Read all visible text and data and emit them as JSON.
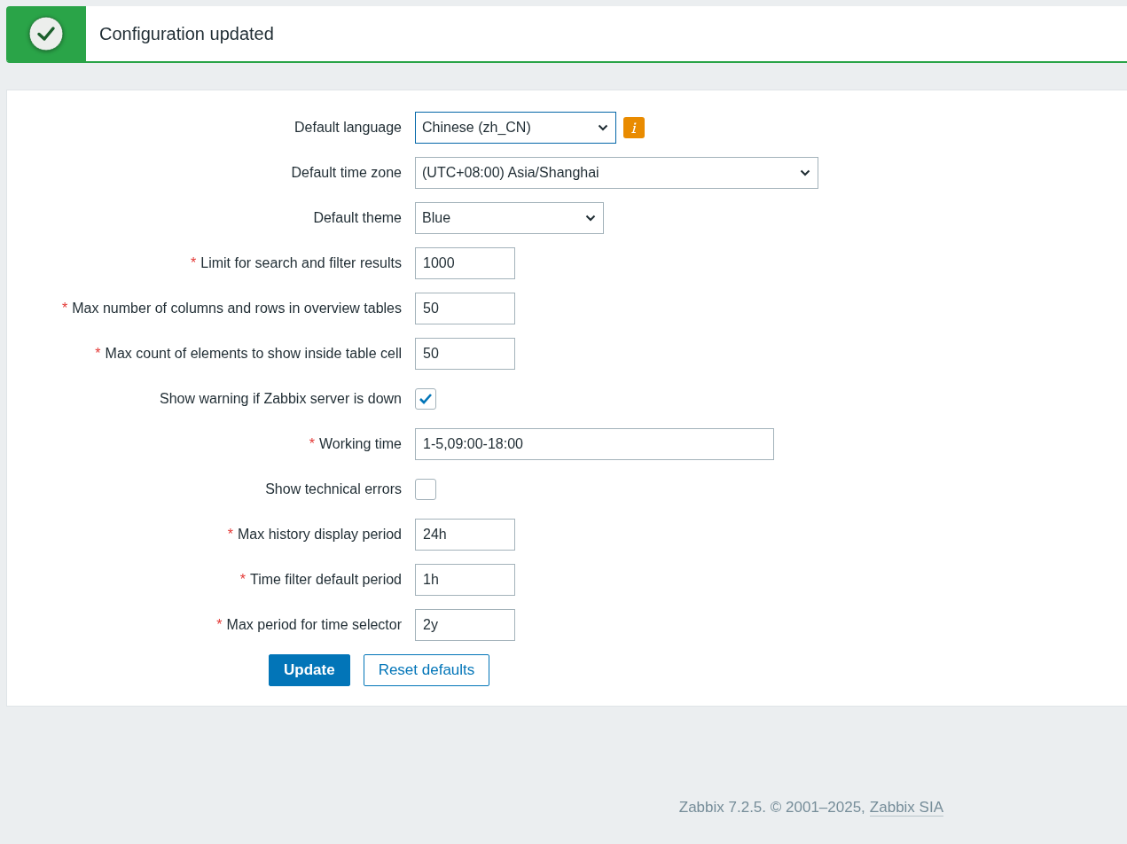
{
  "message": {
    "text": "Configuration updated"
  },
  "form": {
    "rows": [
      {
        "label": "Default language",
        "kind": "select",
        "value": "Chinese (zh_CN)",
        "focused": true,
        "info": true
      },
      {
        "label": "Default time zone",
        "kind": "select",
        "value": "(UTC+08:00) Asia/Shanghai",
        "focused": false
      },
      {
        "label": "Default theme",
        "kind": "select",
        "value": "Blue",
        "focused": false
      },
      {
        "required_mark": "*",
        "label": "Limit for search and filter results",
        "kind": "input",
        "value": "1000"
      },
      {
        "required_mark": "*",
        "label": "Max number of columns and rows in overview tables",
        "kind": "input",
        "value": "50"
      },
      {
        "required_mark": "*",
        "label": "Max count of elements to show inside table cell",
        "kind": "input",
        "value": "50"
      },
      {
        "label": "Show warning if Zabbix server is down",
        "kind": "checkbox",
        "checked": true
      },
      {
        "required_mark": "*",
        "label": "Working time",
        "kind": "input",
        "value": "1-5,09:00-18:00"
      },
      {
        "label": "Show technical errors",
        "kind": "checkbox",
        "checked": false
      },
      {
        "required_mark": "*",
        "label": "Max history display period",
        "kind": "input",
        "value": "24h"
      },
      {
        "required_mark": "*",
        "label": "Time filter default period",
        "kind": "input",
        "value": "1h"
      },
      {
        "required_mark": "*",
        "label": "Max period for time selector",
        "kind": "input",
        "value": "2y"
      }
    ],
    "buttons": [
      {
        "label": "Update",
        "kind": "primary"
      },
      {
        "label": "Reset defaults",
        "kind": "secondary"
      }
    ]
  },
  "footer": {
    "text": "Zabbix 7.2.5. © 2001–2025,",
    "link": "Zabbix SIA"
  }
}
